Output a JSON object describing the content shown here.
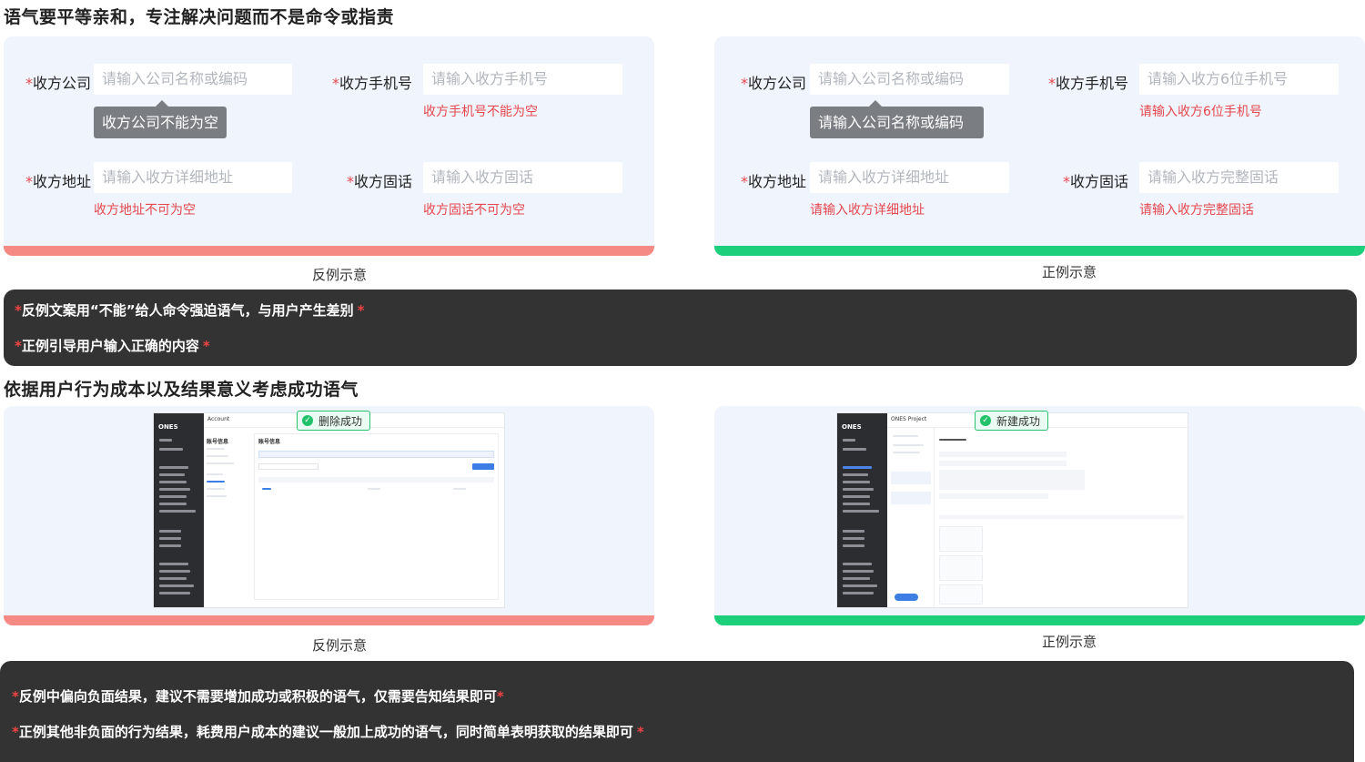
{
  "section1": {
    "title": "语气要平等亲和，专注解决问题而不是命令或指责",
    "bad": {
      "company_label": "收方公司",
      "company_placeholder": "请输入公司名称或编码",
      "company_tip": "收方公司不能为空",
      "phone_label": "收方手机号",
      "phone_placeholder": "请输入收方手机号",
      "phone_error": "收方手机号不能为空",
      "address_label": "收方地址",
      "address_placeholder": "请输入收方详细地址",
      "address_error": "收方地址不可为空",
      "tel_label": "收方固话",
      "tel_placeholder": "请输入收方固话",
      "tel_error": "收方固话不可为空",
      "caption": "反例示意"
    },
    "good": {
      "company_label": "收方公司",
      "company_placeholder": "请输入公司名称或编码",
      "company_tip": "请输入公司名称或编码",
      "phone_label": "收方手机号",
      "phone_placeholder": "请输入收方6位手机号",
      "phone_error": "请输入收方6位手机号",
      "address_label": "收方地址",
      "address_placeholder": "请输入收方详细地址",
      "address_error": "请输入收方详细地址",
      "tel_label": "收方固话",
      "tel_placeholder": "请输入收方完整固话",
      "tel_error": "请输入收方完整固话",
      "caption": "正例示意"
    },
    "notes": [
      "反例文案用“不能”给人命令强迫语气，与用户产生差别",
      "正例引导用户输入正确的内容"
    ]
  },
  "section2": {
    "title": "依据用户行为成本以及结果意义考虑成功语气",
    "bad": {
      "toast": "删除成功",
      "app_title": "Account",
      "page_title": "账号信息",
      "caption": "反例示意"
    },
    "good": {
      "toast": "新建成功",
      "app_title": "ONES Project",
      "caption": "正例示意"
    },
    "notes": [
      "反例中偏向负面结果，建议不需要增加成功或积极的语气，仅需要告知结果即可",
      "正例其他非负面的行为结果，耗费用户成本的建议一般加上成功的语气，同时简单表明获取的结果即可"
    ]
  },
  "required_mark": "*",
  "logo_text": "ONES",
  "colors": {
    "bad_bar": "#f58a84",
    "good_bar": "#1ccf7a",
    "error_text": "#e5484d",
    "panel_bg": "#eff4fd",
    "note_bg": "#333333"
  }
}
